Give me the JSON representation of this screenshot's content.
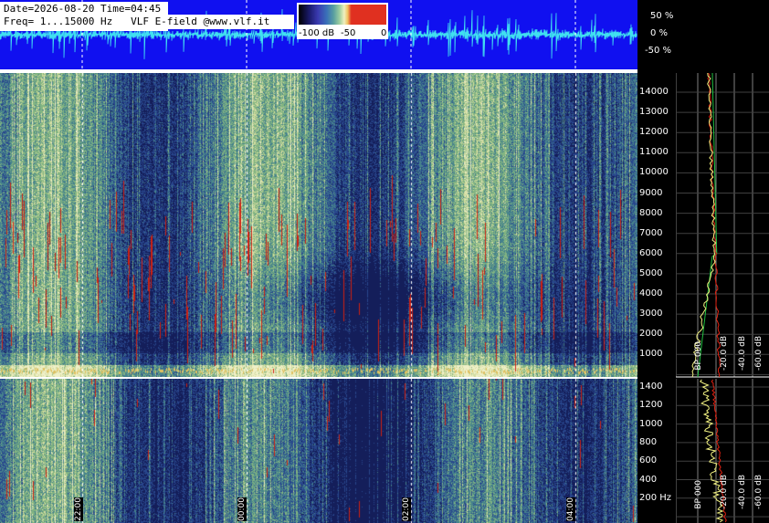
{
  "header": {
    "line1": "Date=2026-08-20 Time=04:45",
    "line2": "Freq= 1...15000 Hz   VLF E-field @www.vlf.it"
  },
  "colorbar": {
    "labels": [
      "-100 dB",
      "-50",
      "0"
    ]
  },
  "waveform_scale": [
    "50 %",
    "0 %",
    "-50 %"
  ],
  "freq_axis_high": [
    "14000",
    "13000",
    "12000",
    "11000",
    "10000",
    "9000",
    "8000",
    "7000",
    "6000",
    "5000",
    "4000",
    "3000",
    "2000",
    "1000"
  ],
  "freq_axis_low": [
    "1400",
    "1200",
    "1000",
    "800",
    "600",
    "400",
    "200 Hz"
  ],
  "time_labels": [
    "22:00",
    "00:00",
    "02:00",
    "04:00"
  ],
  "bp_labels_high": [
    "BP 000",
    "-20.0 dB",
    "-40.0 dB",
    "-60.0 dB"
  ],
  "bp_labels_low": [
    "BP 000",
    "-20.0 dB",
    "-40.0 dB",
    "-60.0 dB"
  ],
  "colors": {
    "waveform_bg": "#1010f0",
    "waveform_trace": "#40e0f0",
    "spectrum_base": "#3a6a90",
    "impulse_red": "#d02010",
    "curve_red": "#e02010",
    "curve_green": "#20c040",
    "curve_yellow": "#f0f080"
  }
}
